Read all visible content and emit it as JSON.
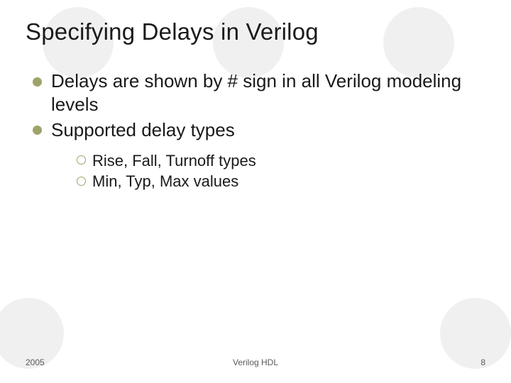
{
  "slide": {
    "title": "Specifying Delays in Verilog",
    "bullets": [
      {
        "text": "Delays are shown by # sign in all Verilog modeling levels"
      },
      {
        "text": "Supported delay types",
        "children": [
          {
            "text": "Rise, Fall, Turnoff types"
          },
          {
            "text": "Min, Typ, Max values"
          }
        ]
      }
    ]
  },
  "footer": {
    "left": "2005",
    "center": "Verilog HDL",
    "right": "8"
  },
  "theme": {
    "bullet_color": "#9fa36a",
    "bg_circle_color": "#f0f0f0"
  }
}
